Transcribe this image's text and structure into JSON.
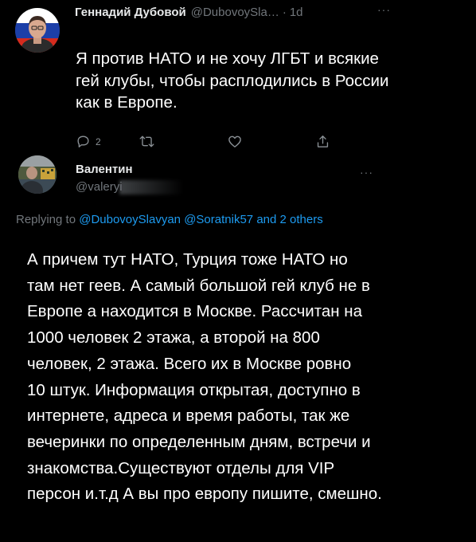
{
  "tweet": {
    "author_name": "Геннадий Дубовой",
    "handle": "@DubovoySla…",
    "separator": "·",
    "time": "1d",
    "more": "···",
    "text_lines": [
      "Я против НАТО и не хочу ЛГБТ и всякие",
      "гей клубы, чтобы расплодились в России",
      "как в  Европе."
    ],
    "actions": {
      "reply_count": "2",
      "retweet_count": "",
      "like_count": ""
    }
  },
  "reply": {
    "author_name": "Валентин",
    "handle": "@valeryi",
    "more": "···",
    "replying_to_prefix": "Replying to",
    "replying_handle_1": "@DubovoySlavyan",
    "replying_handle_2": "@Soratnik57",
    "replying_and": "and",
    "replying_others": "2 others",
    "text_lines": [
      "А причем тут НАТО, Турция тоже НАТО но",
      "там нет геев. А самый большой гей клуб не в",
      "Европе а находится в Москве. Рассчитан на",
      "1000 человек 2 этажа, а второй на 800",
      "человек, 2 этажа.  Всего их в Москве ровно",
      "10 штук. Информация открытая, доступно в",
      "интернете, адреса и время  работы, так же",
      "вечеринки по определенным дням, встречи и",
      "знакомства.Существуют отделы для VIP",
      "персон и.т.д А вы про европу пишите, смешно."
    ]
  },
  "icons": {
    "reply": "reply-icon",
    "retweet": "retweet-icon",
    "like": "heart-icon",
    "share": "share-icon",
    "more": "more-icon"
  },
  "colors": {
    "background": "#000000",
    "text": "#e7e9ea",
    "muted": "#71767b",
    "link": "#1d9bf0",
    "thread_line": "#333639"
  }
}
